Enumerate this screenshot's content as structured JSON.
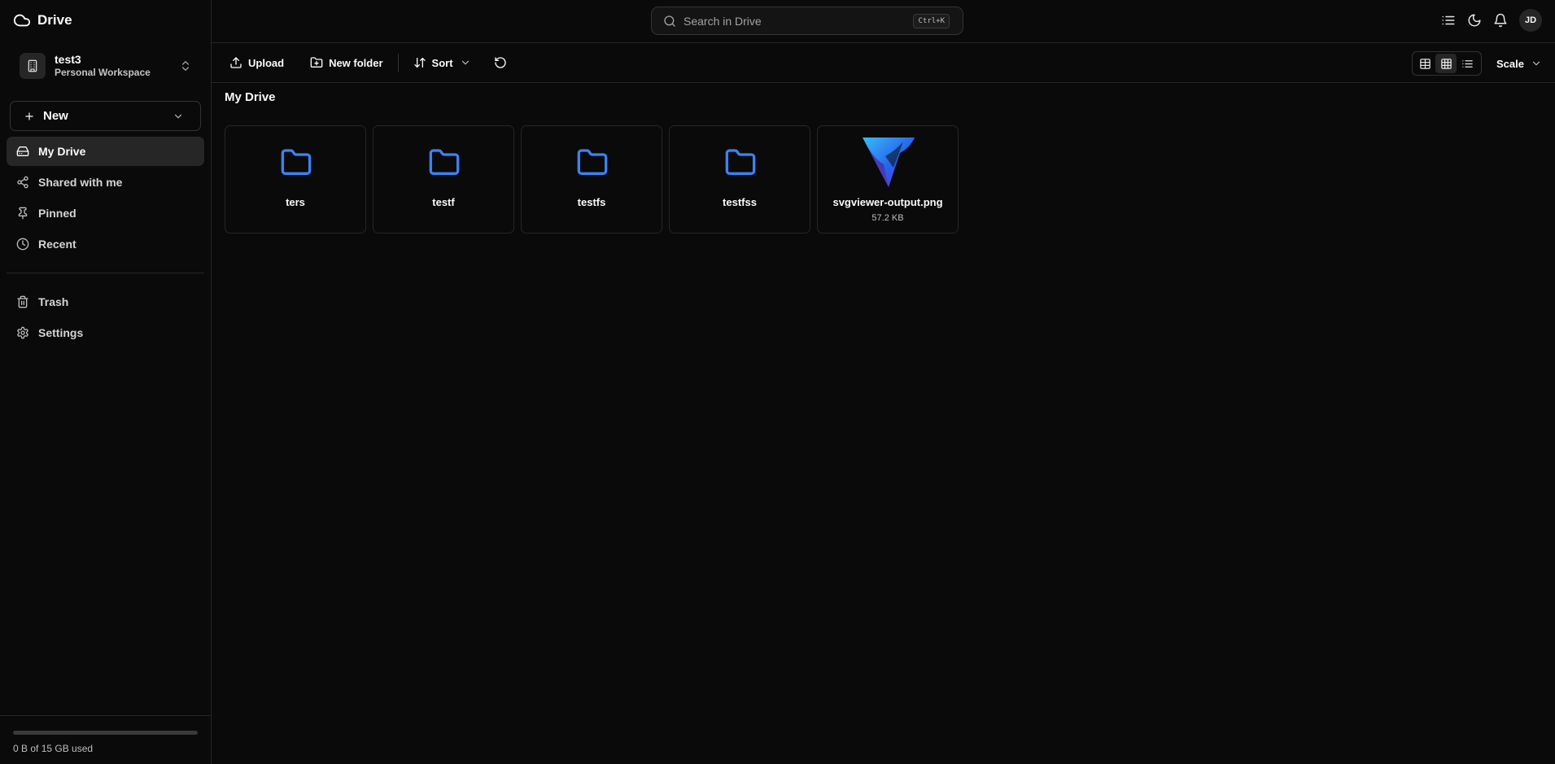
{
  "app": {
    "title": "Drive"
  },
  "workspace": {
    "name": "test3",
    "type": "Personal Workspace"
  },
  "new_button": {
    "label": "New"
  },
  "nav": {
    "items": [
      {
        "label": "My Drive",
        "icon": "hard-drive-icon",
        "active": true
      },
      {
        "label": "Shared with me",
        "icon": "share-icon"
      },
      {
        "label": "Pinned",
        "icon": "pin-icon"
      },
      {
        "label": "Recent",
        "icon": "clock-icon"
      }
    ],
    "secondary": [
      {
        "label": "Trash",
        "icon": "trash-icon"
      },
      {
        "label": "Settings",
        "icon": "gear-icon"
      }
    ]
  },
  "storage": {
    "text": "0 B of 15 GB used",
    "used_fraction": 0
  },
  "search": {
    "placeholder": "Search in Drive",
    "shortcut": "Ctrl+K"
  },
  "user": {
    "initials": "JD"
  },
  "toolbar": {
    "upload_label": "Upload",
    "new_folder_label": "New folder",
    "sort_label": "Sort",
    "scale_label": "Scale",
    "active_view": "grid"
  },
  "page": {
    "title": "My Drive"
  },
  "items": [
    {
      "name": "ters",
      "kind": "folder"
    },
    {
      "name": "testf",
      "kind": "folder"
    },
    {
      "name": "testfs",
      "kind": "folder"
    },
    {
      "name": "testfss",
      "kind": "folder"
    },
    {
      "name": "svgviewer-output.png",
      "kind": "image",
      "size": "57.2 KB"
    }
  ],
  "colors": {
    "background": "#0a0a0a",
    "accent": "#3b82f6",
    "border": "#262626"
  }
}
